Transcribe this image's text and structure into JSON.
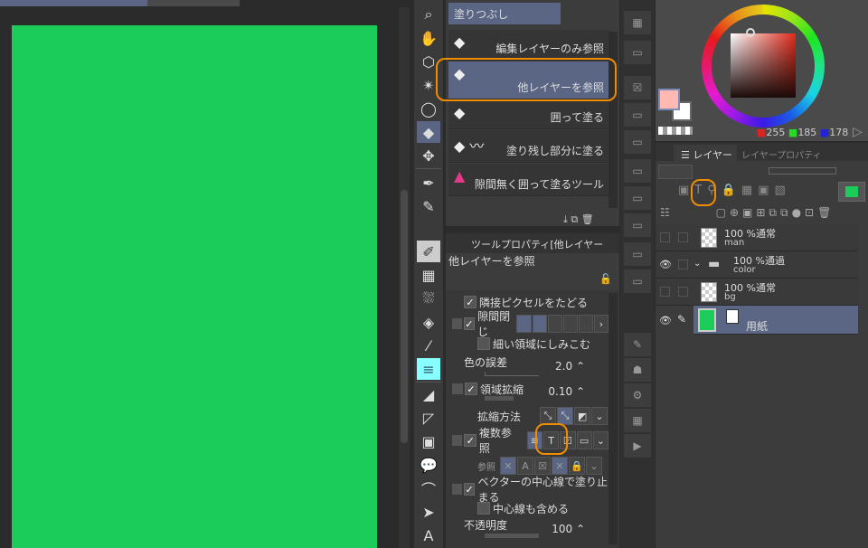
{
  "subtool": {
    "header": "塗りつぶし",
    "items": [
      "編集レイヤーのみ参照",
      "他レイヤーを参照",
      "囲って塗る",
      "塗り残し部分に塗る",
      "隙間無く囲って塗るツール"
    ]
  },
  "toolprop": {
    "title": "ツールプロパティ[他レイヤー",
    "name": "他レイヤーを参照",
    "follow_adjacent": "隣接ピクセルをたどる",
    "close_gap": "隙間閉じ",
    "narrow": "細い領域にしみこむ",
    "tolerance_label": "色の誤差",
    "tolerance": "2.0",
    "expand_label": "領域拡縮",
    "expand": "0.10",
    "expand_method": "拡縮方法",
    "multi_ref": "複数参照",
    "ref_label": "参照",
    "vector_stop": "ベクターの中心線で塗り止まる",
    "include_center": "中心線も含める",
    "opacity_label": "不透明度",
    "opacity": "100"
  },
  "color": {
    "r": "255",
    "g": "185",
    "b": "178",
    "main": "#ffb9b2",
    "sub": "#ffffff"
  },
  "layers": {
    "tab_layer": "レイヤー",
    "tab_prop": "レイヤープロパティ",
    "items": [
      {
        "mode": "100 %通常",
        "name": "man"
      },
      {
        "mode": "100 %通過",
        "name": "color"
      },
      {
        "mode": "100 %通常",
        "name": "bg"
      },
      {
        "mode": "",
        "name": "用紙"
      }
    ]
  },
  "colors": {
    "canvas": "#1bcc5a",
    "accent": "#f08c00",
    "selection": "#5a6684"
  }
}
